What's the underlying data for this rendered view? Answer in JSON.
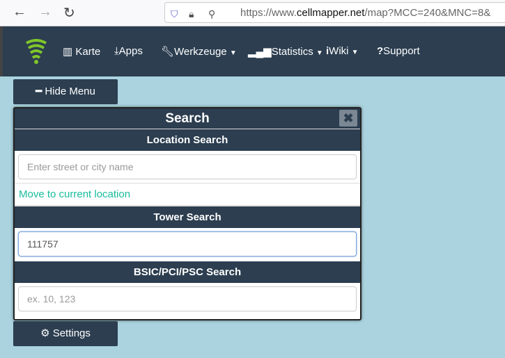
{
  "browser": {
    "url_prefix": "https://www.",
    "url_domain": "cellmapper.net",
    "url_path": "/map?MCC=240&MNC=8&"
  },
  "nav": {
    "items": [
      {
        "label": "Karte",
        "icon": "map-icon"
      },
      {
        "label": "Apps",
        "icon": "download-icon"
      },
      {
        "label": "Werkzeuge",
        "icon": "wrench-icon",
        "dropdown": true
      },
      {
        "label": "Statistics",
        "icon": "signal-icon",
        "dropdown": true
      },
      {
        "label": "Wiki",
        "icon": "info-icon",
        "dropdown": true
      },
      {
        "label": "Support",
        "icon": "question-icon"
      }
    ]
  },
  "hide_menu": "Hide Menu",
  "panel": {
    "title": "Search",
    "location_header": "Location Search",
    "location_placeholder": "Enter street or city name",
    "move_link": "Move to current location",
    "tower_header": "Tower Search",
    "tower_value": "111757",
    "bsic_header": "BSIC/PCI/PSC Search",
    "bsic_placeholder": "ex. 10, 123"
  },
  "settings": "Settings",
  "colors": {
    "navbar": "#2c3e50",
    "map": "#aad3df",
    "link": "#18bc9c"
  }
}
